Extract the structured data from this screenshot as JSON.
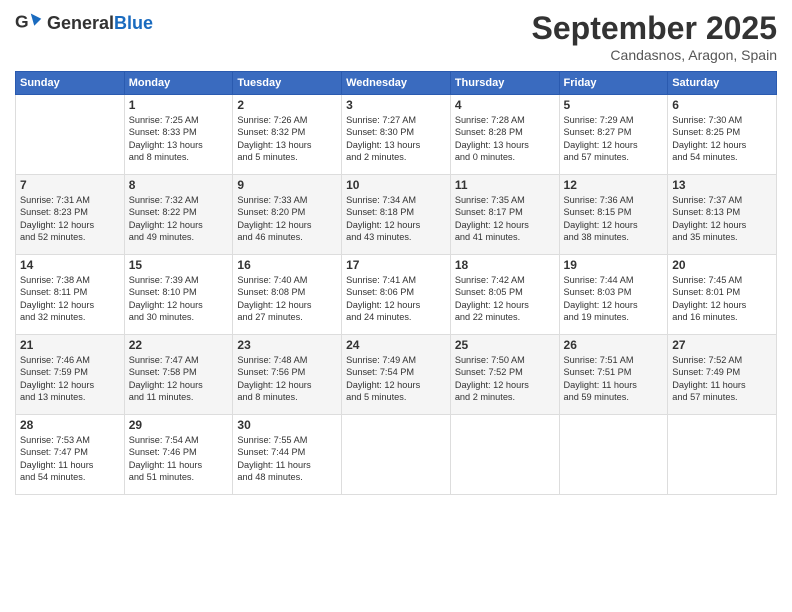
{
  "header": {
    "logo_line1": "General",
    "logo_line2": "Blue",
    "month_title": "September 2025",
    "location": "Candasnos, Aragon, Spain"
  },
  "weekdays": [
    "Sunday",
    "Monday",
    "Tuesday",
    "Wednesday",
    "Thursday",
    "Friday",
    "Saturday"
  ],
  "weeks": [
    [
      {
        "day": "",
        "info": ""
      },
      {
        "day": "1",
        "info": "Sunrise: 7:25 AM\nSunset: 8:33 PM\nDaylight: 13 hours\nand 8 minutes."
      },
      {
        "day": "2",
        "info": "Sunrise: 7:26 AM\nSunset: 8:32 PM\nDaylight: 13 hours\nand 5 minutes."
      },
      {
        "day": "3",
        "info": "Sunrise: 7:27 AM\nSunset: 8:30 PM\nDaylight: 13 hours\nand 2 minutes."
      },
      {
        "day": "4",
        "info": "Sunrise: 7:28 AM\nSunset: 8:28 PM\nDaylight: 13 hours\nand 0 minutes."
      },
      {
        "day": "5",
        "info": "Sunrise: 7:29 AM\nSunset: 8:27 PM\nDaylight: 12 hours\nand 57 minutes."
      },
      {
        "day": "6",
        "info": "Sunrise: 7:30 AM\nSunset: 8:25 PM\nDaylight: 12 hours\nand 54 minutes."
      }
    ],
    [
      {
        "day": "7",
        "info": "Sunrise: 7:31 AM\nSunset: 8:23 PM\nDaylight: 12 hours\nand 52 minutes."
      },
      {
        "day": "8",
        "info": "Sunrise: 7:32 AM\nSunset: 8:22 PM\nDaylight: 12 hours\nand 49 minutes."
      },
      {
        "day": "9",
        "info": "Sunrise: 7:33 AM\nSunset: 8:20 PM\nDaylight: 12 hours\nand 46 minutes."
      },
      {
        "day": "10",
        "info": "Sunrise: 7:34 AM\nSunset: 8:18 PM\nDaylight: 12 hours\nand 43 minutes."
      },
      {
        "day": "11",
        "info": "Sunrise: 7:35 AM\nSunset: 8:17 PM\nDaylight: 12 hours\nand 41 minutes."
      },
      {
        "day": "12",
        "info": "Sunrise: 7:36 AM\nSunset: 8:15 PM\nDaylight: 12 hours\nand 38 minutes."
      },
      {
        "day": "13",
        "info": "Sunrise: 7:37 AM\nSunset: 8:13 PM\nDaylight: 12 hours\nand 35 minutes."
      }
    ],
    [
      {
        "day": "14",
        "info": "Sunrise: 7:38 AM\nSunset: 8:11 PM\nDaylight: 12 hours\nand 32 minutes."
      },
      {
        "day": "15",
        "info": "Sunrise: 7:39 AM\nSunset: 8:10 PM\nDaylight: 12 hours\nand 30 minutes."
      },
      {
        "day": "16",
        "info": "Sunrise: 7:40 AM\nSunset: 8:08 PM\nDaylight: 12 hours\nand 27 minutes."
      },
      {
        "day": "17",
        "info": "Sunrise: 7:41 AM\nSunset: 8:06 PM\nDaylight: 12 hours\nand 24 minutes."
      },
      {
        "day": "18",
        "info": "Sunrise: 7:42 AM\nSunset: 8:05 PM\nDaylight: 12 hours\nand 22 minutes."
      },
      {
        "day": "19",
        "info": "Sunrise: 7:44 AM\nSunset: 8:03 PM\nDaylight: 12 hours\nand 19 minutes."
      },
      {
        "day": "20",
        "info": "Sunrise: 7:45 AM\nSunset: 8:01 PM\nDaylight: 12 hours\nand 16 minutes."
      }
    ],
    [
      {
        "day": "21",
        "info": "Sunrise: 7:46 AM\nSunset: 7:59 PM\nDaylight: 12 hours\nand 13 minutes."
      },
      {
        "day": "22",
        "info": "Sunrise: 7:47 AM\nSunset: 7:58 PM\nDaylight: 12 hours\nand 11 minutes."
      },
      {
        "day": "23",
        "info": "Sunrise: 7:48 AM\nSunset: 7:56 PM\nDaylight: 12 hours\nand 8 minutes."
      },
      {
        "day": "24",
        "info": "Sunrise: 7:49 AM\nSunset: 7:54 PM\nDaylight: 12 hours\nand 5 minutes."
      },
      {
        "day": "25",
        "info": "Sunrise: 7:50 AM\nSunset: 7:52 PM\nDaylight: 12 hours\nand 2 minutes."
      },
      {
        "day": "26",
        "info": "Sunrise: 7:51 AM\nSunset: 7:51 PM\nDaylight: 11 hours\nand 59 minutes."
      },
      {
        "day": "27",
        "info": "Sunrise: 7:52 AM\nSunset: 7:49 PM\nDaylight: 11 hours\nand 57 minutes."
      }
    ],
    [
      {
        "day": "28",
        "info": "Sunrise: 7:53 AM\nSunset: 7:47 PM\nDaylight: 11 hours\nand 54 minutes."
      },
      {
        "day": "29",
        "info": "Sunrise: 7:54 AM\nSunset: 7:46 PM\nDaylight: 11 hours\nand 51 minutes."
      },
      {
        "day": "30",
        "info": "Sunrise: 7:55 AM\nSunset: 7:44 PM\nDaylight: 11 hours\nand 48 minutes."
      },
      {
        "day": "",
        "info": ""
      },
      {
        "day": "",
        "info": ""
      },
      {
        "day": "",
        "info": ""
      },
      {
        "day": "",
        "info": ""
      }
    ]
  ]
}
